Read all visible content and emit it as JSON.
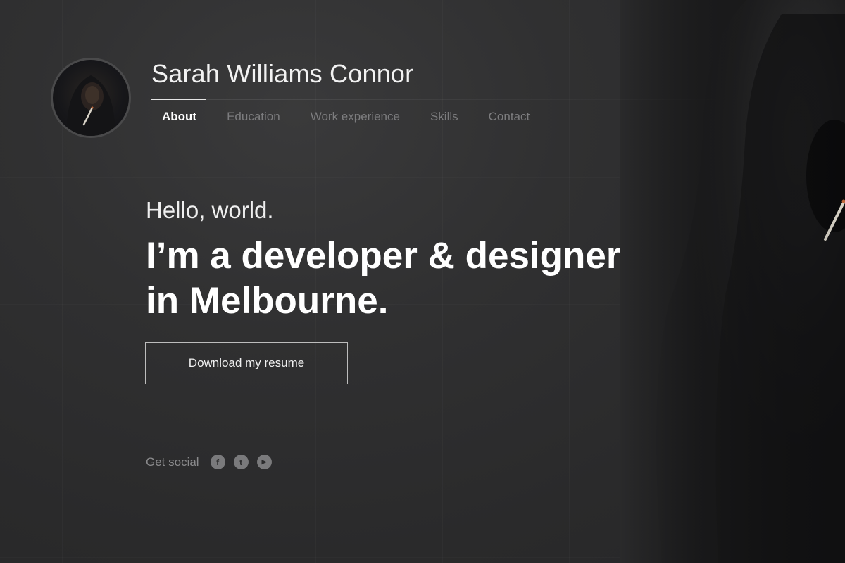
{
  "header": {
    "name": "Sarah Williams Connor"
  },
  "nav": {
    "items": [
      {
        "label": "About",
        "active": true
      },
      {
        "label": "Education",
        "active": false
      },
      {
        "label": "Work experience",
        "active": false
      },
      {
        "label": "Skills",
        "active": false
      },
      {
        "label": "Contact",
        "active": false
      }
    ]
  },
  "hero": {
    "greeting": "Hello, world.",
    "headline_line1": "I’m a developer & designer",
    "headline_line2": "in Melbourne."
  },
  "cta": {
    "resume_label": "Download my resume"
  },
  "social": {
    "label": "Get social",
    "icons": [
      {
        "name": "facebook-icon",
        "glyph": "f"
      },
      {
        "name": "twitter-icon",
        "glyph": "t"
      },
      {
        "name": "youtube-icon",
        "glyph": "▶"
      }
    ]
  },
  "colors": {
    "background": "#2b2b2c",
    "text_primary": "#ffffff",
    "text_muted": "#7c7c7e",
    "button_border": "#bdbdbd"
  }
}
